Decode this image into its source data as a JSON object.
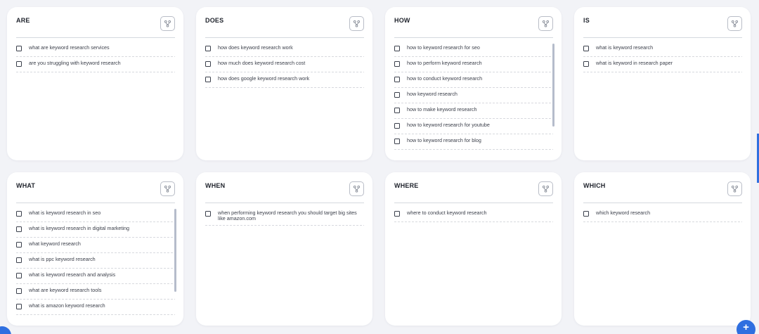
{
  "cards": [
    {
      "title": "ARE",
      "items": [
        "what are keyword research services",
        "are you struggling with keyword research"
      ]
    },
    {
      "title": "DOES",
      "items": [
        "how does keyword research work",
        "how much does keyword research cost",
        "how does google keyword research work"
      ]
    },
    {
      "title": "HOW",
      "items": [
        "how to keyword research for seo",
        "how to perform keyword research",
        "how to conduct keyword research",
        "how keyword research",
        "how to make keyword research",
        "how to keyword research for youtube",
        "how to keyword research for blog"
      ]
    },
    {
      "title": "IS",
      "items": [
        "what is keyword research",
        "what is keyword in research paper"
      ]
    },
    {
      "title": "WHAT",
      "items": [
        "what is keyword research in seo",
        "what is keyword research in digital marketing",
        "what keyword research",
        "what is ppc keyword research",
        "what is keyword research and analysis",
        "what are keyword research tools",
        "what is amazon keyword research"
      ]
    },
    {
      "title": "WHEN",
      "items": [
        "when performing keyword research you should target big sites like amazon.com"
      ]
    },
    {
      "title": "WHERE",
      "items": [
        "where to conduct keyword research"
      ]
    },
    {
      "title": "WHICH",
      "items": [
        "which keyword research"
      ]
    }
  ],
  "icons": {
    "share": "share-icon",
    "fab": "plus-icon"
  },
  "fab_label": "+",
  "colors": {
    "background": "#f2f3f7",
    "card": "#ffffff",
    "accent": "#2f6fe0",
    "scrollbar": "#b5bccb"
  }
}
